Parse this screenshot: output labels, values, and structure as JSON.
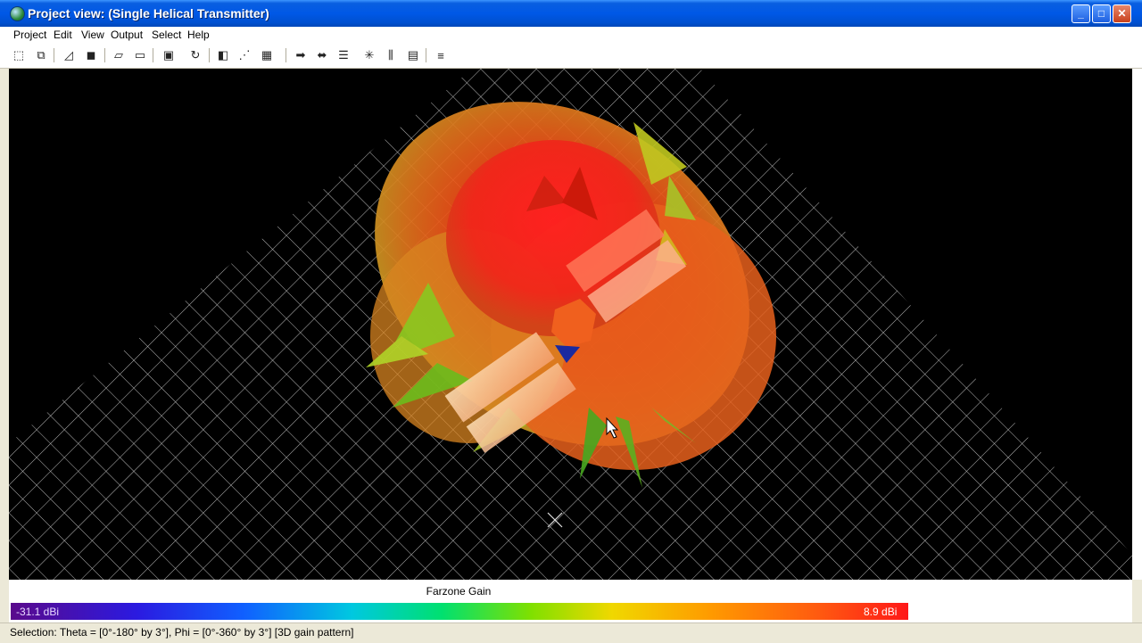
{
  "window": {
    "title": "Project view: (Single Helical Transmitter)"
  },
  "menu": {
    "items": [
      "Project",
      "Edit",
      "View",
      "Output",
      "Select",
      "Help"
    ]
  },
  "toolbar": {
    "icons": [
      "new-view-icon",
      "cascade-view-icon",
      "wireframe-icon",
      "solid-icon",
      "perspective-icon",
      "orthographic-icon",
      "camera-icon",
      "rotate-view-icon",
      "render-icon",
      "ray-paths-icon",
      "grid-icon",
      "move-right-icon",
      "move-left-icon",
      "align-icon",
      "transmitter-icon",
      "receiver-icon",
      "layers-icon",
      "ruler-icon"
    ]
  },
  "legend": {
    "title": "Farzone Gain",
    "min_label": "-31.1 dBi",
    "max_label": "8.9 dBi"
  },
  "status": {
    "text": "Selection: Theta = [0°-180° by 3°], Phi = [0°-360° by 3°] [3D gain pattern]"
  }
}
